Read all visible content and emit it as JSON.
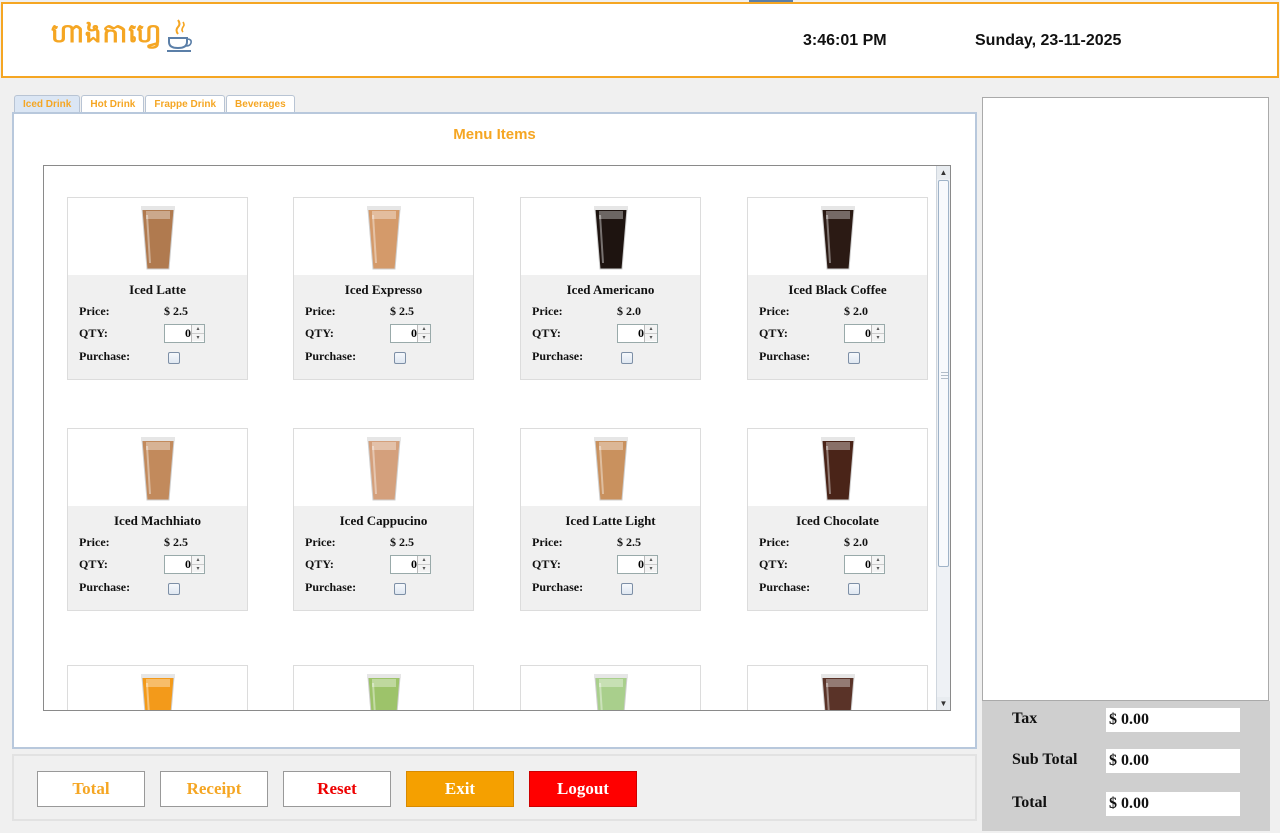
{
  "header": {
    "logo_text": "ហាងកាហ្វេ",
    "logo_icon": "java-coffee-cup-icon",
    "time": "3:46:01 PM",
    "date": "Sunday, 23-11-2025"
  },
  "tabs": [
    {
      "label": "Iced Drink",
      "active": true
    },
    {
      "label": "Hot Drink",
      "active": false
    },
    {
      "label": "Frappe Drink",
      "active": false
    },
    {
      "label": "Beverages",
      "active": false
    }
  ],
  "menu": {
    "title": "Menu Items",
    "labels": {
      "price": "Price:",
      "qty": "QTY:",
      "purchase": "Purchase:"
    },
    "items": [
      {
        "name": "Iced Latte",
        "price": "$ 2.5",
        "qty": "0",
        "purchased": false,
        "drink_color": "#b07a4f"
      },
      {
        "name": "Iced Expresso",
        "price": "$ 2.5",
        "qty": "0",
        "purchased": false,
        "drink_color": "#d49a6a"
      },
      {
        "name": "Iced Americano",
        "price": "$ 2.0",
        "qty": "0",
        "purchased": false,
        "drink_color": "#1e1410"
      },
      {
        "name": "Iced Black Coffee",
        "price": "$ 2.0",
        "qty": "0",
        "purchased": false,
        "drink_color": "#2b1a14"
      },
      {
        "name": "Iced Machhiato",
        "price": "$ 2.5",
        "qty": "0",
        "purchased": false,
        "drink_color": "#c28a5c"
      },
      {
        "name": "Iced Cappucino",
        "price": "$ 2.5",
        "qty": "0",
        "purchased": false,
        "drink_color": "#d4a07c"
      },
      {
        "name": "Iced Latte Light",
        "price": "$ 2.5",
        "qty": "0",
        "purchased": false,
        "drink_color": "#c9915e"
      },
      {
        "name": "Iced Chocolate",
        "price": "$ 2.0",
        "qty": "0",
        "purchased": false,
        "drink_color": "#4a2418"
      },
      {
        "drink_color": "#f39a1a"
      },
      {
        "drink_color": "#9dc36a"
      },
      {
        "drink_color": "#a9cf8c"
      },
      {
        "drink_color": "#5a3328"
      }
    ]
  },
  "totals": {
    "tax_label": "Tax",
    "tax_value": "$ 0.00",
    "subtotal_label": "Sub Total",
    "subtotal_value": "$ 0.00",
    "total_label": "Total",
    "total_value": "$ 0.00"
  },
  "buttons": {
    "total": "Total",
    "receipt": "Receipt",
    "reset": "Reset",
    "exit": "Exit",
    "logout": "Logout"
  }
}
